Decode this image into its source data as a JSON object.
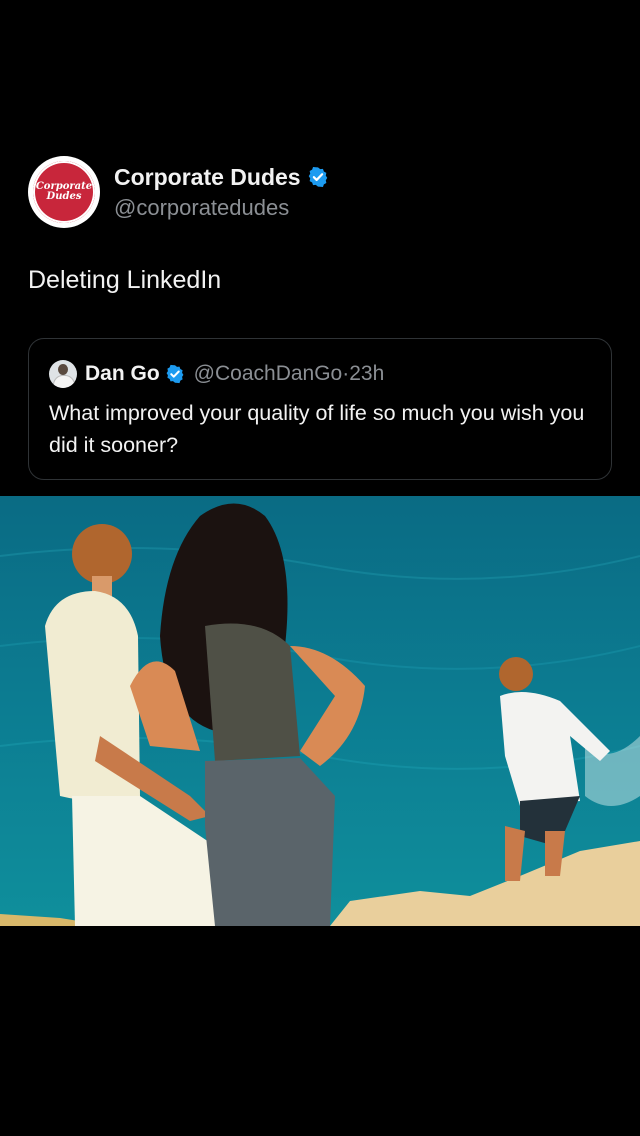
{
  "post": {
    "author_name": "Corporate Dudes",
    "author_handle": "@corporatedudes",
    "avatar_text": [
      "Corporate",
      "Dudes"
    ],
    "text": "Deleting LinkedIn"
  },
  "quote": {
    "author_name": "Dan Go",
    "author_handle": "@CoachDanGo",
    "separator": "·",
    "time": "23h",
    "text": "What improved your quality of life so much you wish you did it sooner?"
  },
  "media": {
    "icon": "photo-icon"
  },
  "colors": {
    "background": "#000000",
    "verified": "#1d9bf0",
    "secondary_text": "#8b8f94",
    "brand_red": "#c8263b"
  }
}
